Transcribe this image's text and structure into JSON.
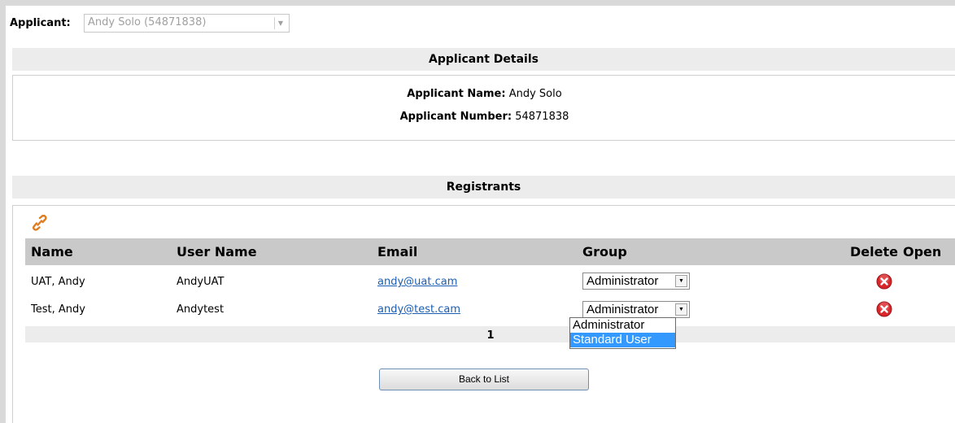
{
  "applicant": {
    "label": "Applicant:",
    "selected_value": "Andy Solo (54871838)"
  },
  "details": {
    "header": "Applicant Details",
    "name_label": "Applicant Name:",
    "name_value": "Andy Solo",
    "number_label": "Applicant Number:",
    "number_value": "54871838"
  },
  "registrants": {
    "header": "Registrants",
    "link_icon": "link-icon",
    "columns": {
      "name": "Name",
      "user_name": "User Name",
      "email": "Email",
      "group": "Group",
      "delete": "Delete",
      "open": "Open"
    },
    "rows": [
      {
        "name": "UAT, Andy",
        "user_name": "AndyUAT",
        "email": "andy@uat.cam",
        "group": "Administrator"
      },
      {
        "name": "Test, Andy",
        "user_name": "Andytest",
        "email": "andy@test.cam",
        "group": "Administrator"
      }
    ],
    "group_options": [
      "Administrator",
      "Standard User"
    ],
    "highlighted_option": "Standard User",
    "pager": "1",
    "back_button": "Back to List"
  },
  "colors": {
    "header_bg": "#ececec",
    "table_head_bg": "#c9c9c9",
    "link": "#1a5fb4",
    "delete_red": "#d9262b",
    "highlight": "#3399ff"
  }
}
